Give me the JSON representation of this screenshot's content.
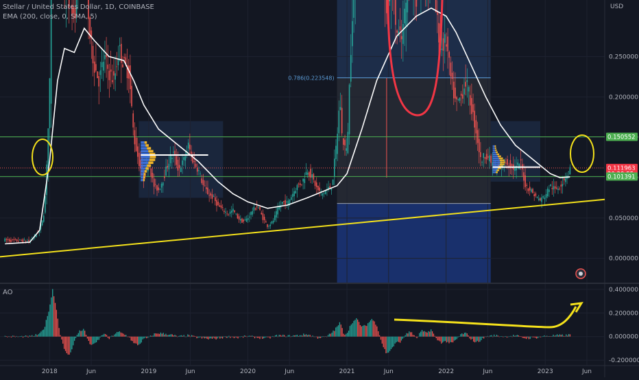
{
  "header": {
    "symbol_line": "Stellar / United States Dollar, 1D, COINBASE",
    "indicator_line": "EMA (200, close, 0, SMA, 5)",
    "currency": "USD"
  },
  "ao_panel": {
    "label": "AO"
  },
  "colors": {
    "background": "#131722",
    "grid": "#1e2230",
    "up": "#26a69a",
    "down": "#ef5350",
    "ema": "#ffffff",
    "trendline": "#f5e21b",
    "annotation_red": "#f23645",
    "green_level": "#4caf50",
    "fib_line": "#5b9bd5",
    "blue_box": "#1c3a86",
    "grey_box": "#3a3d48",
    "profile_bar": "#3d6fd6",
    "profile_bar_hi": "#f0b429"
  },
  "chart_data": [
    {
      "type": "candlestick",
      "title": "Stellar / United States Dollar, 1D, COINBASE",
      "x_ticks": [
        "2018",
        "Jun",
        "2019",
        "Jun",
        "2020",
        "Jun",
        "2021",
        "Jun",
        "2022",
        "Jun",
        "2023",
        "Jun"
      ],
      "y_ticks": [
        "0.000000",
        "0.050000",
        "0.100000",
        "0.150000",
        "0.200000",
        "0.250000"
      ],
      "ylim": [
        -0.03,
        0.32
      ],
      "xlim": [
        2017.5,
        2023.6
      ],
      "price_labels": [
        {
          "text": "0.150552",
          "value": 0.150552,
          "color": "#4caf50"
        },
        {
          "text": "0.111963",
          "value": 0.111963,
          "color": "#f23645"
        },
        {
          "text": "20:29:55",
          "value": 0.1045,
          "color": "#f23645"
        },
        {
          "text": "0.101391",
          "value": 0.101391,
          "color": "#4caf50"
        }
      ],
      "horizontal_levels": [
        {
          "name": "resistance",
          "value": 0.150552
        },
        {
          "name": "support",
          "value": 0.101391
        }
      ],
      "fib_label": "0.786(0.223548)",
      "fib_value": 0.223548,
      "price_path": [
        [
          2017.55,
          0.023
        ],
        [
          2017.6,
          0.022
        ],
        [
          2017.7,
          0.022
        ],
        [
          2017.8,
          0.021
        ],
        [
          2017.85,
          0.028
        ],
        [
          2017.9,
          0.035
        ],
        [
          2017.95,
          0.06
        ],
        [
          2018.0,
          0.2
        ],
        [
          2018.02,
          0.45
        ],
        [
          2018.05,
          0.55
        ],
        [
          2018.08,
          0.4
        ],
        [
          2018.1,
          0.45
        ],
        [
          2018.15,
          0.33
        ],
        [
          2018.2,
          0.32
        ],
        [
          2018.25,
          0.3
        ],
        [
          2018.3,
          0.38
        ],
        [
          2018.35,
          0.4
        ],
        [
          2018.4,
          0.28
        ],
        [
          2018.45,
          0.24
        ],
        [
          2018.5,
          0.22
        ],
        [
          2018.55,
          0.25
        ],
        [
          2018.6,
          0.23
        ],
        [
          2018.65,
          0.22
        ],
        [
          2018.7,
          0.26
        ],
        [
          2018.75,
          0.24
        ],
        [
          2018.8,
          0.23
        ],
        [
          2018.85,
          0.15
        ],
        [
          2018.9,
          0.12
        ],
        [
          2018.95,
          0.1
        ],
        [
          2019.0,
          0.12
        ],
        [
          2019.05,
          0.09
        ],
        [
          2019.1,
          0.085
        ],
        [
          2019.15,
          0.1
        ],
        [
          2019.2,
          0.12
        ],
        [
          2019.25,
          0.13
        ],
        [
          2019.3,
          0.11
        ],
        [
          2019.35,
          0.12
        ],
        [
          2019.4,
          0.14
        ],
        [
          2019.45,
          0.12
        ],
        [
          2019.5,
          0.11
        ],
        [
          2019.55,
          0.09
        ],
        [
          2019.6,
          0.08
        ],
        [
          2019.65,
          0.075
        ],
        [
          2019.7,
          0.065
        ],
        [
          2019.75,
          0.06
        ],
        [
          2019.8,
          0.055
        ],
        [
          2019.85,
          0.06
        ],
        [
          2019.9,
          0.05
        ],
        [
          2019.95,
          0.045
        ],
        [
          2020.0,
          0.05
        ],
        [
          2020.05,
          0.06
        ],
        [
          2020.1,
          0.065
        ],
        [
          2020.15,
          0.05
        ],
        [
          2020.2,
          0.04
        ],
        [
          2020.25,
          0.045
        ],
        [
          2020.3,
          0.06
        ],
        [
          2020.35,
          0.07
        ],
        [
          2020.4,
          0.068
        ],
        [
          2020.45,
          0.08
        ],
        [
          2020.5,
          0.09
        ],
        [
          2020.55,
          0.095
        ],
        [
          2020.6,
          0.11
        ],
        [
          2020.65,
          0.1
        ],
        [
          2020.7,
          0.085
        ],
        [
          2020.75,
          0.08
        ],
        [
          2020.8,
          0.085
        ],
        [
          2020.85,
          0.09
        ],
        [
          2020.9,
          0.15
        ],
        [
          2020.93,
          0.2
        ],
        [
          2020.95,
          0.15
        ],
        [
          2021.0,
          0.13
        ],
        [
          2021.05,
          0.3
        ],
        [
          2021.1,
          0.38
        ],
        [
          2021.15,
          0.42
        ],
        [
          2021.2,
          0.45
        ],
        [
          2021.25,
          0.55
        ],
        [
          2021.3,
          0.58
        ],
        [
          2021.35,
          0.4
        ],
        [
          2021.4,
          0.3
        ],
        [
          2021.45,
          0.35
        ],
        [
          2021.5,
          0.28
        ],
        [
          2021.55,
          0.27
        ],
        [
          2021.6,
          0.32
        ],
        [
          2021.65,
          0.35
        ],
        [
          2021.7,
          0.32
        ],
        [
          2021.75,
          0.36
        ],
        [
          2021.8,
          0.33
        ],
        [
          2021.85,
          0.38
        ],
        [
          2021.9,
          0.3
        ],
        [
          2021.95,
          0.26
        ],
        [
          2022.0,
          0.27
        ],
        [
          2022.05,
          0.22
        ],
        [
          2022.1,
          0.19
        ],
        [
          2022.15,
          0.2
        ],
        [
          2022.2,
          0.22
        ],
        [
          2022.25,
          0.19
        ],
        [
          2022.3,
          0.16
        ],
        [
          2022.35,
          0.12
        ],
        [
          2022.4,
          0.13
        ],
        [
          2022.45,
          0.12
        ],
        [
          2022.5,
          0.11
        ],
        [
          2022.55,
          0.115
        ],
        [
          2022.6,
          0.12
        ],
        [
          2022.65,
          0.115
        ],
        [
          2022.7,
          0.11
        ],
        [
          2022.75,
          0.12
        ],
        [
          2022.8,
          0.09
        ],
        [
          2022.85,
          0.085
        ],
        [
          2022.9,
          0.077
        ],
        [
          2022.95,
          0.072
        ],
        [
          2023.0,
          0.078
        ],
        [
          2023.05,
          0.09
        ],
        [
          2023.1,
          0.085
        ],
        [
          2023.15,
          0.09
        ],
        [
          2023.2,
          0.1
        ],
        [
          2023.25,
          0.112
        ]
      ],
      "ema_path": [
        [
          2017.55,
          0.018
        ],
        [
          2017.8,
          0.02
        ],
        [
          2017.9,
          0.035
        ],
        [
          2018.0,
          0.12
        ],
        [
          2018.08,
          0.22
        ],
        [
          2018.15,
          0.26
        ],
        [
          2018.25,
          0.255
        ],
        [
          2018.35,
          0.285
        ],
        [
          2018.45,
          0.27
        ],
        [
          2018.6,
          0.25
        ],
        [
          2018.75,
          0.245
        ],
        [
          2018.85,
          0.22
        ],
        [
          2018.95,
          0.19
        ],
        [
          2019.1,
          0.16
        ],
        [
          2019.3,
          0.14
        ],
        [
          2019.5,
          0.12
        ],
        [
          2019.7,
          0.095
        ],
        [
          2019.85,
          0.08
        ],
        [
          2020.0,
          0.07
        ],
        [
          2020.2,
          0.062
        ],
        [
          2020.4,
          0.066
        ],
        [
          2020.6,
          0.075
        ],
        [
          2020.8,
          0.085
        ],
        [
          2020.9,
          0.09
        ],
        [
          2021.0,
          0.105
        ],
        [
          2021.15,
          0.16
        ],
        [
          2021.3,
          0.22
        ],
        [
          2021.5,
          0.275
        ],
        [
          2021.7,
          0.3
        ],
        [
          2021.85,
          0.31
        ],
        [
          2022.0,
          0.3
        ],
        [
          2022.1,
          0.28
        ],
        [
          2022.25,
          0.24
        ],
        [
          2022.4,
          0.2
        ],
        [
          2022.55,
          0.165
        ],
        [
          2022.7,
          0.14
        ],
        [
          2022.85,
          0.125
        ],
        [
          2022.95,
          0.115
        ],
        [
          2023.05,
          0.105
        ],
        [
          2023.15,
          0.1
        ],
        [
          2023.25,
          0.101
        ]
      ],
      "trendline": [
        [
          2017.5,
          0.002
        ],
        [
          2023.6,
          0.073
        ]
      ]
    },
    {
      "type": "histogram",
      "title": "AO",
      "y_ticks": [
        "0.400000",
        "0.200000",
        "0.000000",
        "-0.200000"
      ],
      "ylim": [
        -0.24,
        0.44
      ],
      "ao_path": [
        [
          2017.55,
          0.0
        ],
        [
          2017.8,
          0.0
        ],
        [
          2017.9,
          0.02
        ],
        [
          2017.95,
          0.08
        ],
        [
          2018.0,
          0.25
        ],
        [
          2018.03,
          0.4
        ],
        [
          2018.06,
          0.28
        ],
        [
          2018.1,
          0.05
        ],
        [
          2018.15,
          -0.12
        ],
        [
          2018.2,
          -0.16
        ],
        [
          2018.25,
          -0.04
        ],
        [
          2018.3,
          0.05
        ],
        [
          2018.35,
          0.06
        ],
        [
          2018.4,
          -0.06
        ],
        [
          2018.45,
          -0.07
        ],
        [
          2018.5,
          -0.02
        ],
        [
          2018.55,
          0.03
        ],
        [
          2018.6,
          -0.02
        ],
        [
          2018.65,
          0.02
        ],
        [
          2018.7,
          0.04
        ],
        [
          2018.75,
          0.02
        ],
        [
          2018.8,
          0.0
        ],
        [
          2018.85,
          -0.06
        ],
        [
          2018.9,
          -0.07
        ],
        [
          2018.95,
          -0.02
        ],
        [
          2019.0,
          -0.01
        ],
        [
          2019.05,
          0.02
        ],
        [
          2019.1,
          0.03
        ],
        [
          2019.2,
          0.02
        ],
        [
          2019.3,
          0.0
        ],
        [
          2019.4,
          0.01
        ],
        [
          2019.5,
          -0.01
        ],
        [
          2019.6,
          -0.02
        ],
        [
          2019.7,
          -0.015
        ],
        [
          2019.8,
          0.0
        ],
        [
          2019.9,
          -0.01
        ],
        [
          2020.0,
          0.005
        ],
        [
          2020.1,
          -0.01
        ],
        [
          2020.2,
          -0.015
        ],
        [
          2020.3,
          0.01
        ],
        [
          2020.4,
          0.005
        ],
        [
          2020.5,
          0.01
        ],
        [
          2020.6,
          0.02
        ],
        [
          2020.7,
          -0.01
        ],
        [
          2020.8,
          0.0
        ],
        [
          2020.88,
          0.06
        ],
        [
          2020.93,
          0.12
        ],
        [
          2020.97,
          0.02
        ],
        [
          2021.0,
          0.03
        ],
        [
          2021.05,
          0.12
        ],
        [
          2021.1,
          0.15
        ],
        [
          2021.15,
          0.08
        ],
        [
          2021.2,
          0.1
        ],
        [
          2021.25,
          0.15
        ],
        [
          2021.3,
          0.1
        ],
        [
          2021.35,
          -0.05
        ],
        [
          2021.4,
          -0.15
        ],
        [
          2021.45,
          -0.1
        ],
        [
          2021.5,
          -0.05
        ],
        [
          2021.55,
          -0.04
        ],
        [
          2021.6,
          0.03
        ],
        [
          2021.65,
          0.04
        ],
        [
          2021.7,
          -0.02
        ],
        [
          2021.75,
          0.05
        ],
        [
          2021.8,
          0.03
        ],
        [
          2021.85,
          0.06
        ],
        [
          2021.9,
          -0.02
        ],
        [
          2021.95,
          -0.05
        ],
        [
          2022.0,
          -0.04
        ],
        [
          2022.05,
          -0.06
        ],
        [
          2022.1,
          -0.03
        ],
        [
          2022.15,
          0.02
        ],
        [
          2022.2,
          0.03
        ],
        [
          2022.25,
          -0.02
        ],
        [
          2022.3,
          -0.05
        ],
        [
          2022.35,
          -0.03
        ],
        [
          2022.4,
          0.0
        ],
        [
          2022.5,
          0.01
        ],
        [
          2022.6,
          0.0
        ],
        [
          2022.7,
          0.01
        ],
        [
          2022.8,
          -0.015
        ],
        [
          2022.9,
          -0.01
        ],
        [
          2023.0,
          0.005
        ],
        [
          2023.1,
          0.01
        ],
        [
          2023.2,
          0.01
        ],
        [
          2023.25,
          0.015
        ]
      ]
    }
  ]
}
